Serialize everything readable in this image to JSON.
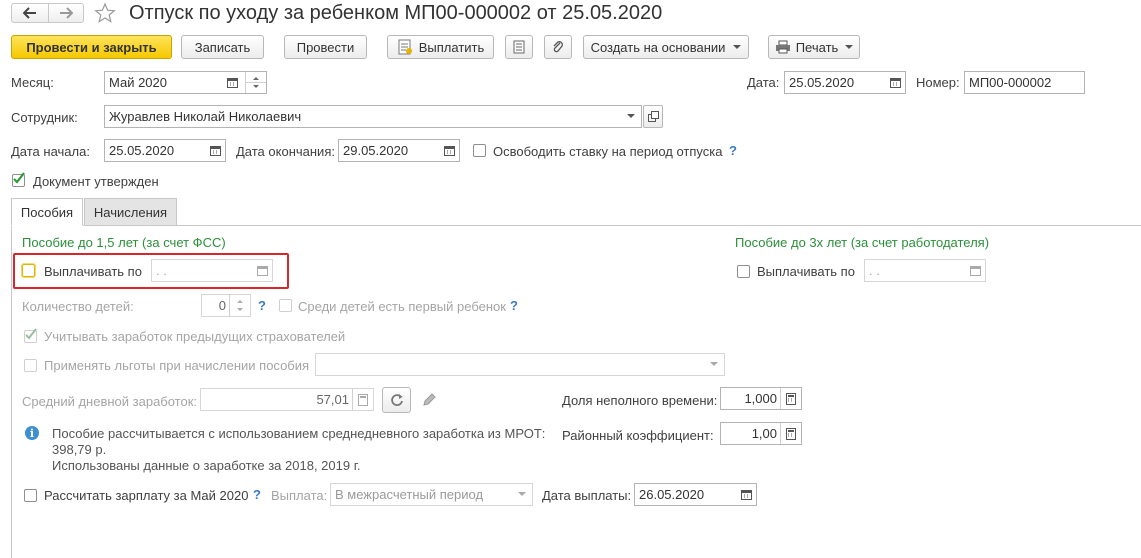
{
  "window": {
    "title": "Отпуск по уходу за ребенком МП00-000002 от 25.05.2020",
    "nav_back_icon": "arrow-left-icon",
    "nav_forward_icon": "arrow-right-icon",
    "favorite_icon": "star-icon"
  },
  "toolbar": {
    "post_close": "Провести и закрыть",
    "save": "Записать",
    "post": "Провести",
    "pay": "Выплатить",
    "create_based": "Создать на основании",
    "print": "Печать"
  },
  "header": {
    "month_label": "Месяц:",
    "month_value": "Май 2020",
    "date_label": "Дата:",
    "date_value": "25.05.2020",
    "number_label": "Номер:",
    "number_value": "МП00-000002",
    "employee_label": "Сотрудник:",
    "employee_value": "Журавлев Николай Николаевич",
    "start_label": "Дата начала:",
    "start_value": "25.05.2020",
    "end_label": "Дата окончания:",
    "end_value": "29.05.2020",
    "release_rate_label": "Освободить ставку на период отпуска",
    "release_rate_help": "?",
    "approved_label": "Документ утвержден"
  },
  "tabs": [
    "Пособия",
    "Начисления"
  ],
  "benefits": {
    "fss_heading": "Пособие до 1,5 лет (за счет ФСС)",
    "employer_heading": "Пособие до 3х лет (за счет работодателя)",
    "pay_until_label": "Выплачивать по",
    "pay_until_value": " .  .",
    "pay_until_employer_label": "Выплачивать по",
    "pay_until_employer_value": " .  .",
    "children_count_label": "Количество детей:",
    "children_count_value": "0",
    "children_help": "?",
    "first_child_label": "Среди детей есть первый ребенок",
    "first_child_help": "?",
    "prev_insurers_label": "Учитывать заработок предыдущих страхователей",
    "apply_benefits_label": "Применять льготы при начислении пособия",
    "avg_daily_label": "Средний дневной заработок:",
    "avg_daily_value": "57,01",
    "part_time_label": "Доля неполного времени:",
    "part_time_value": "1,000",
    "regional_label": "Районный коэффициент:",
    "regional_value": "1,00",
    "info_line1": "Пособие рассчитывается с использованием среднедневного заработка из МРОТ:",
    "info_line2": "398,79 р.",
    "info_line3": "Использованы данные о заработке за  2018,  2019 г.",
    "calc_salary_label": "Рассчитать зарплату за Май 2020",
    "calc_salary_help": "?",
    "payout_label": "Выплата:",
    "payout_value": "В межрасчетный период",
    "pay_date_label": "Дата выплаты:",
    "pay_date_value": "26.05.2020"
  },
  "colors": {
    "primary_button": "#f5c800",
    "section_heading": "#2c8f3a",
    "highlight_border": "#d9262c",
    "help": "#3d7bc2"
  }
}
